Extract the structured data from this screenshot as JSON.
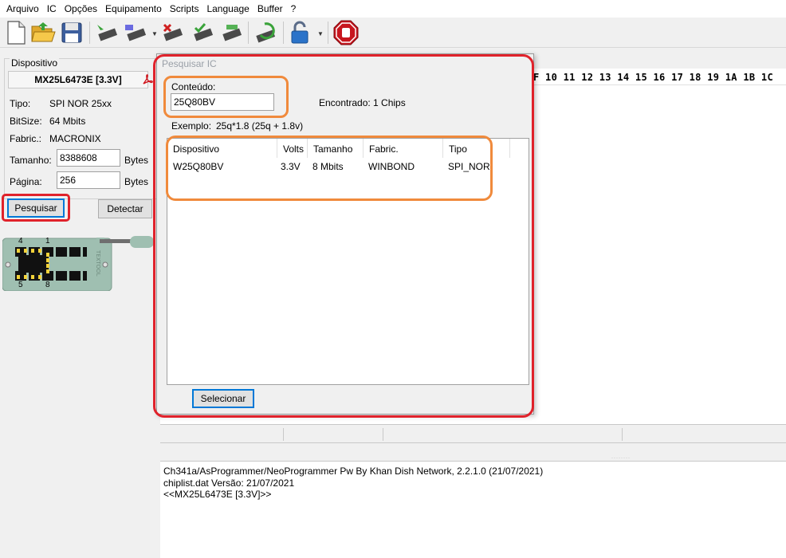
{
  "menu": [
    "Arquivo",
    "IC",
    "Opções",
    "Equipamento",
    "Scripts",
    "Language",
    "Buffer",
    "?"
  ],
  "toolbar_icons": [
    "new-file-icon",
    "open-folder-icon",
    "save-icon",
    "read-chip-icon",
    "write-chip-icon",
    "erase-chip-icon",
    "verify-chip-icon",
    "blank-check-icon",
    "auto-program-icon",
    "protection-lock-icon",
    "stop-icon"
  ],
  "device": {
    "group_label": "Dispositivo",
    "name": "MX25L6473E [3.3V]",
    "tipo_label": "Tipo:",
    "tipo_value": "SPI NOR  25xx",
    "bitsize_label": "BitSize:",
    "bitsize_value": "64 Mbits",
    "fabric_label": "Fabric.:",
    "fabric_value": "MACRONIX",
    "tamanho_label": "Tamanho:",
    "tamanho_value": "8388608",
    "tamanho_unit": "Bytes",
    "pagina_label": "Página:",
    "pagina_value": "256",
    "pagina_unit": "Bytes",
    "pesquisar_button": "Pesquisar",
    "detectar_button": "Detectar"
  },
  "socket": {
    "pin_top_left": "4",
    "pin_top_right": "1",
    "pin_bottom_left": "5",
    "pin_bottom_right": "8",
    "brand": "TEXTOOL"
  },
  "hex_header": "F 10 11 12 13 14 15 16 17 18 19 1A 1B 1C",
  "dialog": {
    "title": "Pesquisar IC",
    "conteudo_label": "Conteúdo:",
    "conteudo_value": "25Q80BV",
    "found_text": "Encontrado: 1  Chips",
    "example_label": "Exemplo:",
    "example_value": "25q*1.8 (25q + 1.8v)",
    "columns": [
      "Dispositivo",
      "Volts",
      "Tamanho",
      "Fabric.",
      "Tipo"
    ],
    "rows": [
      {
        "dispositivo": "W25Q80BV",
        "volts": "3.3V",
        "tamanho": "8 Mbits",
        "fabric": "WINBOND",
        "tipo": "SPI_NOR"
      }
    ],
    "select_button": "Selecionar"
  },
  "log": [
    "Ch341a/AsProgrammer/NeoProgrammer Pw By Khan Dish Network, 2.2.1.0 (21/07/2021)",
    "chiplist.dat Versão: 21/07/2021",
    "<<MX25L6473E [3.3V]>>"
  ],
  "colors": {
    "highlight_red": "#e0222b",
    "highlight_orange": "#f08a3c",
    "button_focus": "#0078d7",
    "socket_green": "#9fbfb1"
  }
}
